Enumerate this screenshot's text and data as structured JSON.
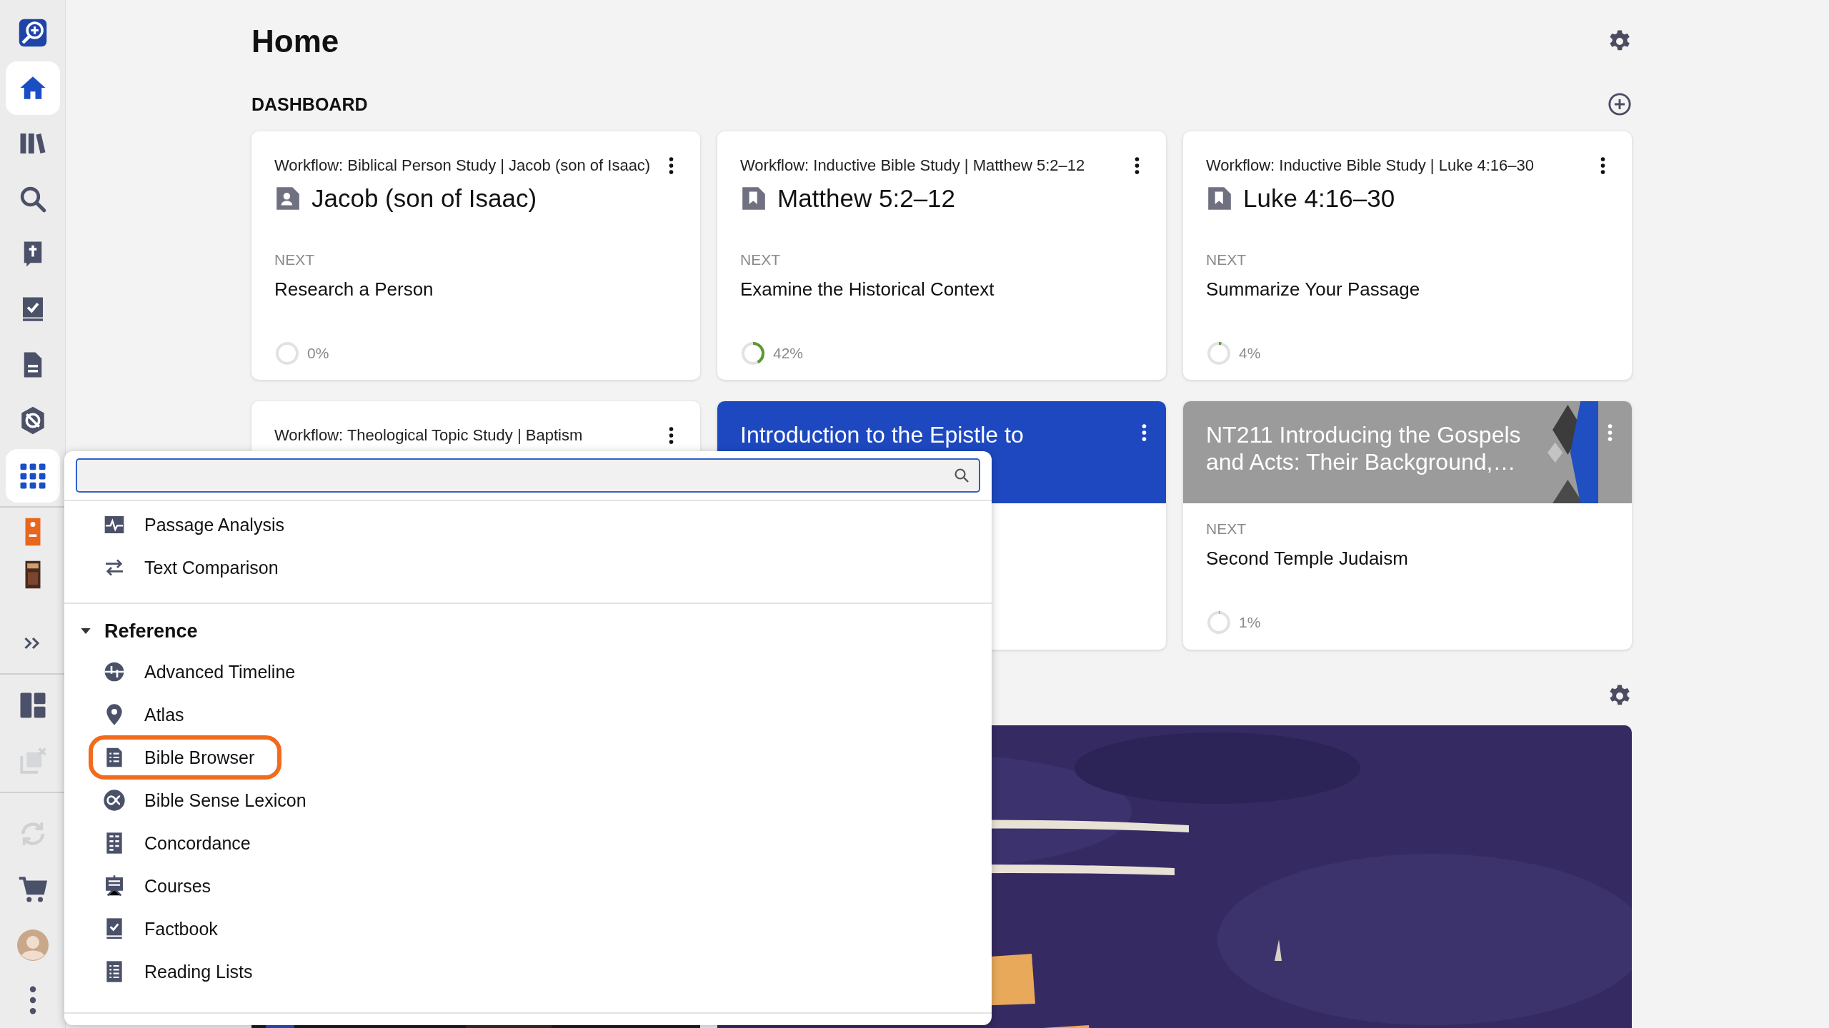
{
  "sidebar": {
    "items": [
      {
        "selected": false,
        "disabled": false
      },
      {
        "selected": true,
        "disabled": false
      },
      {
        "selected": false,
        "disabled": false
      },
      {
        "selected": false,
        "disabled": false
      },
      {
        "selected": false,
        "disabled": false
      },
      {
        "selected": false,
        "disabled": false
      },
      {
        "selected": false,
        "disabled": false
      },
      {
        "selected": false,
        "disabled": false
      },
      {
        "selected": true,
        "disabled": false
      },
      {
        "selected": false,
        "disabled": false
      },
      {
        "selected": false,
        "disabled": false
      },
      {
        "selected": false,
        "disabled": false
      },
      {
        "selected": false,
        "disabled": false
      },
      {
        "selected": false,
        "disabled": true
      },
      {
        "selected": false,
        "disabled": true
      },
      {
        "selected": false,
        "disabled": false
      },
      {
        "selected": false,
        "disabled": false
      },
      {
        "selected": false,
        "disabled": false
      }
    ]
  },
  "page": {
    "title": "Home",
    "section": "DASHBOARD"
  },
  "cards": [
    {
      "kind": "person",
      "workflow": "Workflow: Biblical Person Study | Jacob (son of Isaac)",
      "title": "Jacob (son of Isaac)",
      "next_label": "NEXT",
      "next": "Research a Person",
      "progress": "0%",
      "level": 0
    },
    {
      "kind": "passage",
      "workflow": "Workflow: Inductive Bible Study | Matthew 5:2–12",
      "title": "Matthew 5:2–12",
      "next_label": "NEXT",
      "next": "Examine the Historical Context",
      "progress": "42%",
      "level": 0.42
    },
    {
      "kind": "passage",
      "workflow": "Workflow: Inductive Bible Study | Luke 4:16–30",
      "title": "Luke 4:16–30",
      "next_label": "NEXT",
      "next": "Summarize Your Passage",
      "progress": "4%",
      "level": 0.04
    },
    {
      "kind": "topic",
      "workflow": "Workflow: Theological Topic Study | Baptism"
    },
    {
      "kind": "course",
      "color": "#1d48c0",
      "title": "Introduction to the Epistle to"
    },
    {
      "kind": "course",
      "color": "#9b9b9b",
      "title": "NT211 Introducing the Gospels and Acts: Their Background,…",
      "next_label": "NEXT",
      "next": "Second Temple Judaism",
      "progress": "1%",
      "level": 0.01
    }
  ],
  "menu": {
    "groups": [
      {
        "items": [
          {
            "label": "Passage Analysis",
            "highlighted": false
          },
          {
            "label": "Text Comparison",
            "highlighted": false
          }
        ]
      },
      {
        "title": "Reference",
        "expanded": true,
        "items": [
          {
            "label": "Advanced Timeline",
            "highlighted": false
          },
          {
            "label": "Atlas",
            "highlighted": false
          },
          {
            "label": "Bible Browser",
            "highlighted": true
          },
          {
            "label": "Bible Sense Lexicon",
            "highlighted": false
          },
          {
            "label": "Concordance",
            "highlighted": false
          },
          {
            "label": "Courses",
            "highlighted": false
          },
          {
            "label": "Factbook",
            "highlighted": false
          },
          {
            "label": "Reading Lists",
            "highlighted": false
          }
        ]
      }
    ]
  }
}
